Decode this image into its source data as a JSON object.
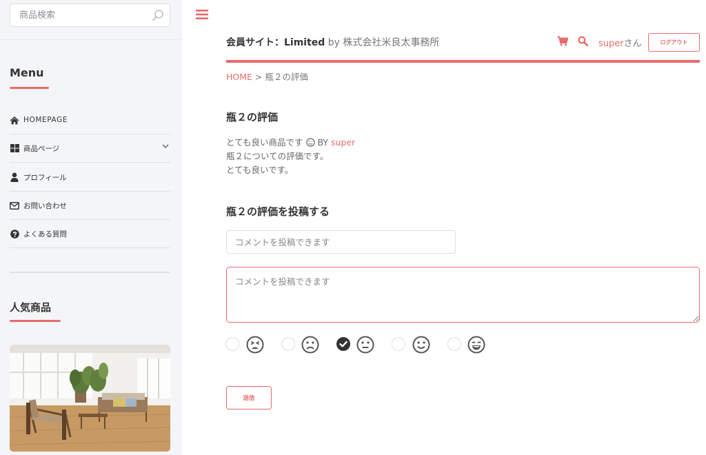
{
  "sidebar": {
    "search": {
      "placeholder": "商品検索"
    },
    "menu_title": "Menu",
    "menu_items": [
      {
        "label": "HOMEPAGE",
        "icon": "home-icon"
      },
      {
        "label": "商品ページ",
        "icon": "grid-icon",
        "has_submenu": true
      },
      {
        "label": "プロフィール",
        "icon": "user-icon"
      },
      {
        "label": "お問い合わせ",
        "icon": "envelope-icon"
      },
      {
        "label": "よくある質問",
        "icon": "question-circle-icon"
      }
    ],
    "popular_title": "人気商品"
  },
  "header": {
    "site_name": "会員サイト：Limited",
    "by": "by",
    "company": "株式会社米良太事務所",
    "user_name": "super",
    "user_suffix": "さん",
    "logout_label": "ログアウト"
  },
  "breadcrumb": {
    "home": "HOME",
    "separator": ">",
    "current": "瓶２の評価"
  },
  "review": {
    "title": "瓶２の評価",
    "line1_text": "とても良い商品です",
    "line1_by": "BY",
    "line1_user": "super",
    "line2": "瓶２についての評価です。",
    "line3": "とても良いです。"
  },
  "post": {
    "title": "瓶２の評価を投稿する",
    "comment_placeholder": "コメントを投稿できます",
    "textarea_placeholder": "コメントを投稿できます",
    "ratings": [
      {
        "icon": "tired-face-icon",
        "checked": false
      },
      {
        "icon": "frown-face-icon",
        "checked": false
      },
      {
        "icon": "neutral-face-icon",
        "checked": true
      },
      {
        "icon": "smile-face-icon",
        "checked": false
      },
      {
        "icon": "laugh-face-icon",
        "checked": false
      }
    ],
    "submit_label": "送信"
  },
  "colors": {
    "accent": "#e86a6a",
    "sidebar_bg": "#f4f5f7",
    "text": "#333333"
  }
}
